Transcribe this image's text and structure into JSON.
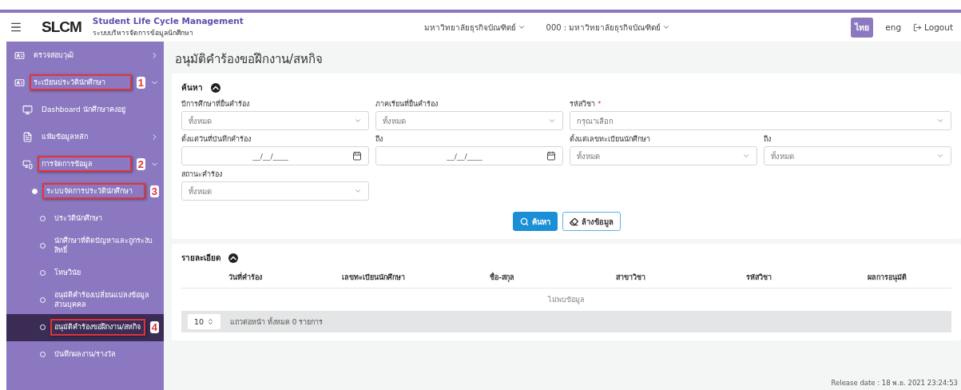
{
  "header": {
    "logo": "SLCM",
    "title": "Student Life Cycle Management",
    "subtitle": "ระบบบริหารจัดการข้อมูลนักศึกษา",
    "selectors": [
      "มหาวิทยาลัยธุรกิจบัณฑิตย์",
      "000 : มหาวิทยาลัยธุรกิจบัณฑิตย์"
    ],
    "languages": [
      {
        "label": "ไทย",
        "selected": true
      },
      {
        "label": "eng",
        "selected": false
      }
    ],
    "logout": "Logout"
  },
  "sidebar": {
    "items": [
      {
        "label": "ตรวจสอบวุฒิ",
        "kind": "group",
        "expanded": false,
        "selected": false
      },
      {
        "label": "ระเบียนประวัตินักศึกษา",
        "kind": "group",
        "expanded": true,
        "selected": false,
        "callout": "1",
        "children": [
          {
            "label": "Dashboard นักศึกษาคงอยู่",
            "kind": "link",
            "selected": false
          },
          {
            "label": "แฟ้มข้อมูลหลัก",
            "kind": "group",
            "expanded": false,
            "selected": false
          },
          {
            "label": "การจัดการข้อมูล",
            "kind": "group",
            "expanded": true,
            "selected": false,
            "callout": "2",
            "children": [
              {
                "label": "ระบบจัดการประวัตินักศึกษา",
                "kind": "heading",
                "selected": false,
                "callout": "3",
                "children": [
                  {
                    "label": "ประวัตินักศึกษา",
                    "kind": "bullet",
                    "selected": false
                  },
                  {
                    "label": "นักศึกษาที่ติดปัญหาและถูกระงับสิทธิ์",
                    "kind": "bullet",
                    "selected": false
                  },
                  {
                    "label": "โทษวินัย",
                    "kind": "bullet",
                    "selected": false
                  },
                  {
                    "label": "อนุมัติคำร้องเปลี่ยนแปลงข้อมูลส่วนบุคคล",
                    "kind": "bullet",
                    "selected": false
                  },
                  {
                    "label": "อนุมัติคำร้องขอฝึกงาน/สหกิจ",
                    "kind": "bullet",
                    "selected": true,
                    "callout": "4"
                  },
                  {
                    "label": "บันทึกผลงาน/รางวัล",
                    "kind": "bullet",
                    "selected": false
                  }
                ]
              }
            ]
          }
        ]
      }
    ]
  },
  "page_title": "อนุมัติคำร้องขอฝึกงาน/สหกิจ",
  "search": {
    "title": "ค้นหา",
    "expanded": true,
    "rows": [
      [
        {
          "label": "ปีการศึกษาที่ยื่นคำร้อง",
          "kind": "select",
          "value": "ทั้งหมด"
        },
        {
          "label": "ภาคเรียนที่ยื่นคำร้อง",
          "kind": "select",
          "value": "ทั้งหมด"
        },
        {
          "label": "รหัสวิชา",
          "kind": "select",
          "placeholder": "กรุณาเลือก",
          "required_mark": "*"
        }
      ],
      [
        {
          "label": "ตั้งแต่วันที่บันทึกคำร้อง",
          "kind": "date",
          "placeholder": "__/__/____"
        },
        {
          "label": "ถึง",
          "kind": "date",
          "placeholder": "__/__/____"
        },
        {
          "label": "ตั้งแต่เลขทะเบียนนักศึกษา",
          "kind": "select",
          "value": "ทั้งหมด"
        },
        {
          "label": "ถึง",
          "kind": "select",
          "value": "ทั้งหมด"
        }
      ],
      [
        {
          "label": "สถานะคำร้อง",
          "kind": "select",
          "value": "ทั้งหมด"
        }
      ]
    ],
    "buttons": [
      {
        "label": "ค้นหา",
        "kind": "primary"
      },
      {
        "label": "ล้างข้อมูล",
        "kind": "outline"
      }
    ]
  },
  "details": {
    "title": "รายละเอียด",
    "expanded": true,
    "table": {
      "columns": [
        "วันที่คำร้อง",
        "เลขทะเบียนนักศึกษา",
        "ชื่อ-สกุล",
        "สาขาวิชา",
        "รหัสวิชา",
        "ผลการอนุมัติ"
      ],
      "empty_message": "ไม่พบข้อมูล"
    },
    "page_size": "10",
    "footer_text": "แถวต่อหน้า ทั้งหมด 0 รายการ"
  },
  "release": "Release date : 18 พ.ย. 2021 23:24:53"
}
